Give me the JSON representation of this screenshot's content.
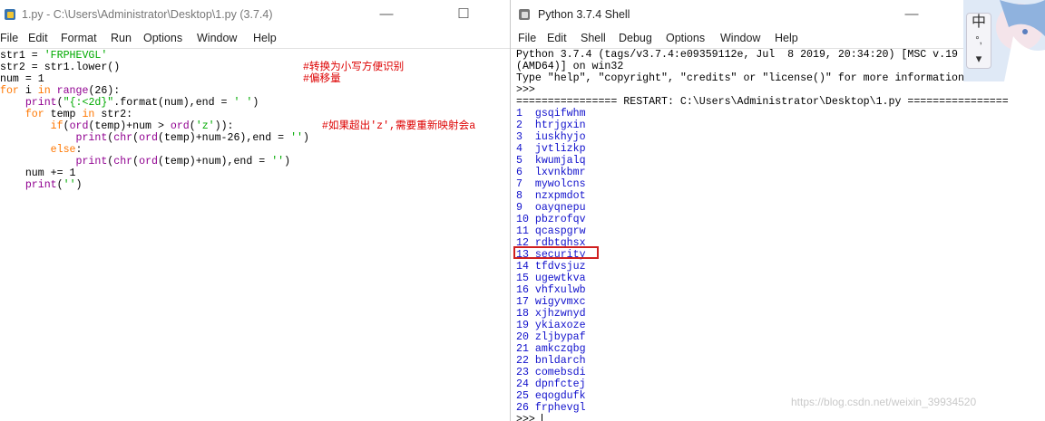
{
  "editor": {
    "title": "1.py - C:\\Users\\Administrator\\Desktop\\1.py (3.7.4)",
    "menu": [
      "File",
      "Edit",
      "Format",
      "Run",
      "Options",
      "Window",
      "Help"
    ],
    "code_lines": [
      [
        [
          "str1 = ",
          ""
        ],
        [
          "'FRPHEVGL'",
          "st"
        ]
      ],
      [
        [
          "str2 = str1.lower()",
          ""
        ],
        [
          "                             #转换为小写方便识别",
          "cm"
        ]
      ],
      [
        [
          "num = 1",
          ""
        ],
        [
          "                                         #偏移量",
          "cm"
        ]
      ],
      [
        [
          "for",
          "kw"
        ],
        [
          " i ",
          ""
        ],
        [
          "in",
          "kw"
        ],
        [
          " ",
          ""
        ],
        [
          "range",
          "bi"
        ],
        [
          "(26):",
          ""
        ]
      ],
      [
        [
          "    ",
          ""
        ],
        [
          "print",
          "bi"
        ],
        [
          "(",
          ""
        ],
        [
          "\"{:<2d}\"",
          "st"
        ],
        [
          ".format(num),end = ",
          ""
        ],
        [
          "' '",
          "st"
        ],
        [
          ")",
          ""
        ]
      ],
      [
        [
          "    ",
          ""
        ],
        [
          "for",
          "kw"
        ],
        [
          " temp ",
          ""
        ],
        [
          "in",
          "kw"
        ],
        [
          " str2:",
          ""
        ]
      ],
      [
        [
          "        ",
          ""
        ],
        [
          "if",
          "kw"
        ],
        [
          "(",
          ""
        ],
        [
          "ord",
          "bi"
        ],
        [
          "(temp)+num > ",
          ""
        ],
        [
          "ord",
          "bi"
        ],
        [
          "(",
          ""
        ],
        [
          "'z'",
          "st"
        ],
        [
          ")):",
          ""
        ],
        [
          "              #如果超出'z',需要重新映射会a",
          "cm"
        ]
      ],
      [
        [
          "            ",
          ""
        ],
        [
          "print",
          "bi"
        ],
        [
          "(",
          ""
        ],
        [
          "chr",
          "bi"
        ],
        [
          "(",
          ""
        ],
        [
          "ord",
          "bi"
        ],
        [
          "(temp)+num-26),end = ",
          ""
        ],
        [
          "''",
          "st"
        ],
        [
          ")",
          ""
        ]
      ],
      [
        [
          "        ",
          ""
        ],
        [
          "else",
          "kw"
        ],
        [
          ":",
          ""
        ]
      ],
      [
        [
          "            ",
          ""
        ],
        [
          "print",
          "bi"
        ],
        [
          "(",
          ""
        ],
        [
          "chr",
          "bi"
        ],
        [
          "(",
          ""
        ],
        [
          "ord",
          "bi"
        ],
        [
          "(temp)+num),end = ",
          ""
        ],
        [
          "''",
          "st"
        ],
        [
          ")",
          ""
        ]
      ],
      [
        [
          "    num += 1",
          ""
        ]
      ],
      [
        [
          "    ",
          ""
        ],
        [
          "print",
          "bi"
        ],
        [
          "(",
          ""
        ],
        [
          "''",
          "st"
        ],
        [
          ")",
          ""
        ]
      ]
    ]
  },
  "shell": {
    "title": "Python 3.7.4 Shell",
    "menu": [
      "File",
      "Edit",
      "Shell",
      "Debug",
      "Options",
      "Window",
      "Help"
    ],
    "header_lines": [
      "Python 3.7.4 (tags/v3.7.4:e09359112e, Jul  8 2019, 20:34:20) [MSC v.19",
      "(AMD64)] on win32",
      "Type \"help\", \"copyright\", \"credits\" or \"license()\" for more information.",
      ">>> ",
      "================ RESTART: C:\\Users\\Administrator\\Desktop\\1.py ================"
    ],
    "results": [
      {
        "n": "1",
        "s": "gsqifwhm"
      },
      {
        "n": "2",
        "s": "htrjgxin"
      },
      {
        "n": "3",
        "s": "iuskhyjo"
      },
      {
        "n": "4",
        "s": "jvtlizkp"
      },
      {
        "n": "5",
        "s": "kwumjalq"
      },
      {
        "n": "6",
        "s": "lxvnkbmr"
      },
      {
        "n": "7",
        "s": "mywolcns"
      },
      {
        "n": "8",
        "s": "nzxpmdot"
      },
      {
        "n": "9",
        "s": "oayqnepu"
      },
      {
        "n": "10",
        "s": "pbzrofqv"
      },
      {
        "n": "11",
        "s": "qcaspgrw"
      },
      {
        "n": "12",
        "s": "rdbtqhsx"
      },
      {
        "n": "13",
        "s": "security"
      },
      {
        "n": "14",
        "s": "tfdvsjuz"
      },
      {
        "n": "15",
        "s": "ugewtkva"
      },
      {
        "n": "16",
        "s": "vhfxulwb"
      },
      {
        "n": "17",
        "s": "wigyvmxc"
      },
      {
        "n": "18",
        "s": "xjhzwnyd"
      },
      {
        "n": "19",
        "s": "ykiaxoze"
      },
      {
        "n": "20",
        "s": "zljbypaf"
      },
      {
        "n": "21",
        "s": "amkczqbg"
      },
      {
        "n": "22",
        "s": "bnldarch"
      },
      {
        "n": "23",
        "s": "comebsdi"
      },
      {
        "n": "24",
        "s": "dpnfctej"
      },
      {
        "n": "25",
        "s": "eqogdufk"
      },
      {
        "n": "26",
        "s": "frphevgl"
      }
    ],
    "prompt": ">>> "
  },
  "ime_chars": [
    "中",
    "°,",
    "👕"
  ],
  "watermark": "https://blog.csdn.net/weixin_39934520"
}
